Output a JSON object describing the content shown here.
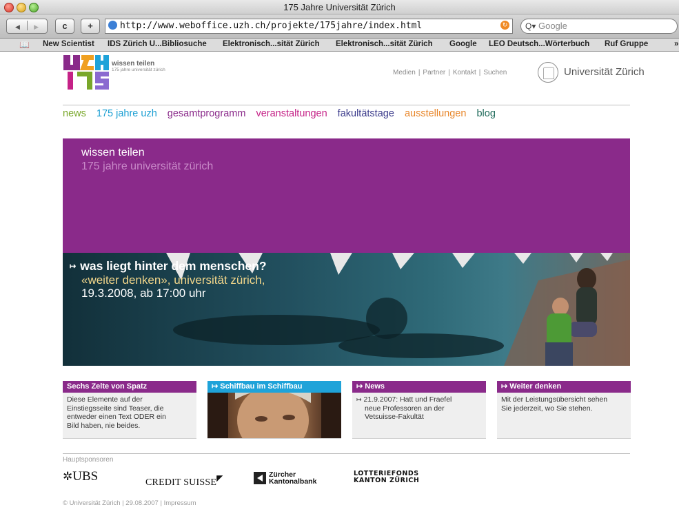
{
  "window": {
    "title": "175 Jahre Universität Zürich"
  },
  "toolbar": {
    "back_glyph": "◀",
    "forward_glyph": "▶",
    "reload_glyph": "c",
    "add_glyph": "+",
    "url": "http://www.weboffice.uzh.ch/projekte/175jahre/index.html",
    "search_placeholder": "Google",
    "search_prefix": "Q▾"
  },
  "bookmarks": [
    "New Scientist",
    "IDS Zürich U...Bibliosuche",
    "Elektronisch...sität Zürich",
    "Elektronisch...sität Zürich",
    "Google",
    "LEO Deutsch...Wörterbuch",
    "Ruf Gruppe"
  ],
  "header": {
    "logo_line1": "wissen teilen",
    "logo_line2": "175 jahre universität zürich",
    "util_links": [
      "Medien",
      "Partner",
      "Kontakt",
      "Suchen"
    ],
    "util_sep": "|",
    "university": "Universität Zürich"
  },
  "nav": [
    {
      "label": "news",
      "color": "#79a72a"
    },
    {
      "label": "175 jahre uzh",
      "color": "#1b9fd3"
    },
    {
      "label": "gesamtprogramm",
      "color": "#8a2a8a"
    },
    {
      "label": "veranstaltungen",
      "color": "#c52287"
    },
    {
      "label": "fakultätstage",
      "color": "#3c3c8c"
    },
    {
      "label": "ausstellungen",
      "color": "#e8862a"
    },
    {
      "label": "blog",
      "color": "#1e6a5a"
    }
  ],
  "hero": {
    "title": "wissen teilen",
    "subtitle": "175 jahre universität zürich",
    "headline": "was liegt hinter dem menschen?",
    "arrow": "↦",
    "line1": "«weiter denken», universität zürich,",
    "line2": "19.3.2008, ab 17:00 uhr",
    "band_color": "#8a2a8a"
  },
  "teasers": [
    {
      "title": "Sechs Zelte von Spatz",
      "color": "#8a2a8a",
      "lines": [
        "Diese Elemente auf der",
        "Einstiegsseite sind Teaser, die",
        "entweder einen Text ODER ein",
        "Bild haben, nie beides."
      ]
    },
    {
      "title": "↦ Schiffbau im Schiffbau",
      "color": "#1fa3d9"
    },
    {
      "title": "↦ News",
      "color": "#8a2a8a",
      "arrow": "↦",
      "lines": [
        "21.9.2007: Hatt und Fraefel",
        "neue Professoren an der",
        "Vetsuisse-Fakultät"
      ]
    },
    {
      "title": "↦ Weiter denken",
      "color": "#8a2a8a",
      "lines": [
        "Mit der Leistungsübersicht sehen",
        "Sie jederzeit, wo Sie stehen."
      ]
    }
  ],
  "sponsors": {
    "label": "Hauptsponsoren",
    "ubs": "UBS",
    "credit_suisse": "CREDIT SUISSE",
    "zkb_line1": "Zürcher",
    "zkb_line2": "Kantonalbank",
    "lotto_line1": "LOTTERIEFONDS",
    "lotto_line2": "KANTON ZÜRICH"
  },
  "footer": "© Universität Zürich | 29.08.2007 | Impressum"
}
